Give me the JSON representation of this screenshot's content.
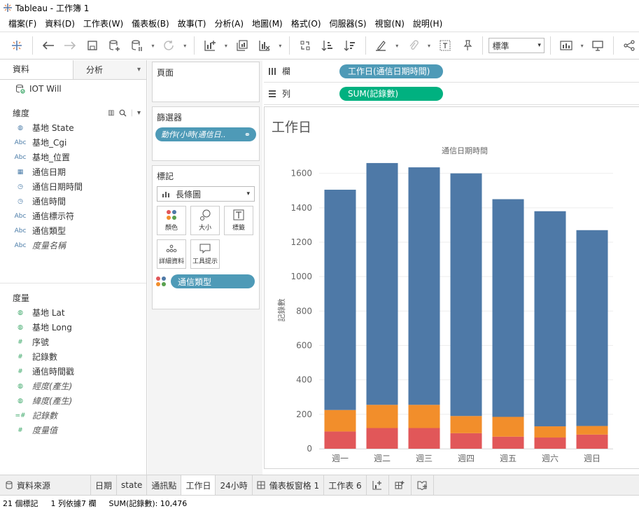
{
  "window": {
    "title": "Tableau - 工作簿 1"
  },
  "menu": [
    "檔案(F)",
    "資料(D)",
    "工作表(W)",
    "儀表板(B)",
    "故事(T)",
    "分析(A)",
    "地圖(M)",
    "格式(O)",
    "伺服器(S)",
    "視窗(N)",
    "說明(H)"
  ],
  "toolbar": {
    "fit_select": "標準"
  },
  "left_panel": {
    "tab_data": "資料",
    "tab_analytics": "分析",
    "datasource": "IOT Will",
    "dimensions_header": "維度",
    "dimensions": [
      {
        "icon": "globe-icon",
        "type": "geo",
        "label": "基地 State"
      },
      {
        "icon": "abc-icon",
        "type": "Abc",
        "label": "基地_Cgi"
      },
      {
        "icon": "abc-icon",
        "type": "Abc",
        "label": "基地_位置"
      },
      {
        "icon": "calendar-icon",
        "type": "date",
        "label": "通信日期"
      },
      {
        "icon": "datetime-icon",
        "type": "datetime",
        "label": "通信日期時間"
      },
      {
        "icon": "datetime-icon",
        "type": "datetime",
        "label": "通信時間"
      },
      {
        "icon": "abc-icon",
        "type": "Abc",
        "label": "通信標示符"
      },
      {
        "icon": "abc-icon",
        "type": "Abc",
        "label": "通信類型"
      },
      {
        "icon": "abc-icon",
        "type": "Abc",
        "label": "度量名稱",
        "italic": true
      }
    ],
    "measures_header": "度量",
    "measures": [
      {
        "icon": "globe-icon",
        "label": "基地 Lat"
      },
      {
        "icon": "globe-icon",
        "label": "基地 Long"
      },
      {
        "icon": "hash-icon",
        "label": "序號"
      },
      {
        "icon": "hash-icon",
        "label": "記錄數"
      },
      {
        "icon": "hash-icon",
        "label": "通信時間戳"
      },
      {
        "icon": "globe-icon",
        "label": "經度(產生)",
        "italic": true
      },
      {
        "icon": "globe-icon",
        "label": "緯度(產生)",
        "italic": true
      },
      {
        "icon": "hash-icon",
        "label": "記錄數",
        "italic": true
      },
      {
        "icon": "hash-icon",
        "label": "度量值",
        "italic": true
      }
    ]
  },
  "cards": {
    "pages": "頁面",
    "filters": "篩選器",
    "filter_pill": "動作(小時(通信日..",
    "marks": "標記",
    "mark_type": "長條圖",
    "mark_buttons": [
      "顏色",
      "大小",
      "標籤",
      "詳細資料",
      "工具提示"
    ],
    "mark_pill": "通信類型"
  },
  "shelves": {
    "columns_label": "欄",
    "columns_pill": "工作日(通信日期時間)",
    "rows_label": "列",
    "rows_pill": "SUM(記錄數)"
  },
  "colors": {
    "blue": "#4e79a7",
    "orange": "#f28e2b",
    "red": "#e15759",
    "pill_dimension": "#4e9ab7",
    "pill_measure": "#00b180"
  },
  "chart_data": {
    "type": "bar",
    "stacked": true,
    "title": "工作日",
    "subtitle": "通信日期時間",
    "ylabel": "記錄數",
    "categories": [
      "週一",
      "週二",
      "週三",
      "週四",
      "週五",
      "週六",
      "週日"
    ],
    "yticks": [
      "0",
      "200",
      "400",
      "600",
      "800",
      "1000",
      "1200",
      "1400",
      "1600"
    ],
    "ylim": [
      0,
      1680
    ],
    "series": [
      {
        "color": "#e15759",
        "values": [
          100,
          120,
          120,
          90,
          70,
          65,
          82
        ]
      },
      {
        "color": "#f28e2b",
        "values": [
          125,
          135,
          135,
          100,
          115,
          65,
          50
        ]
      },
      {
        "color": "#4e79a7",
        "values": [
          1280,
          1405,
          1380,
          1410,
          1265,
          1250,
          1138
        ]
      }
    ]
  },
  "bottom_tabs": [
    "資料來源",
    "日期",
    "state",
    "通訊點",
    "工作日",
    "24小時",
    "儀表板窗格 1",
    "工作表 6"
  ],
  "status": {
    "marks": "21 個標記",
    "rows_cols": "1 列依據7 欄",
    "sum": "SUM(記錄數): 10,476"
  }
}
